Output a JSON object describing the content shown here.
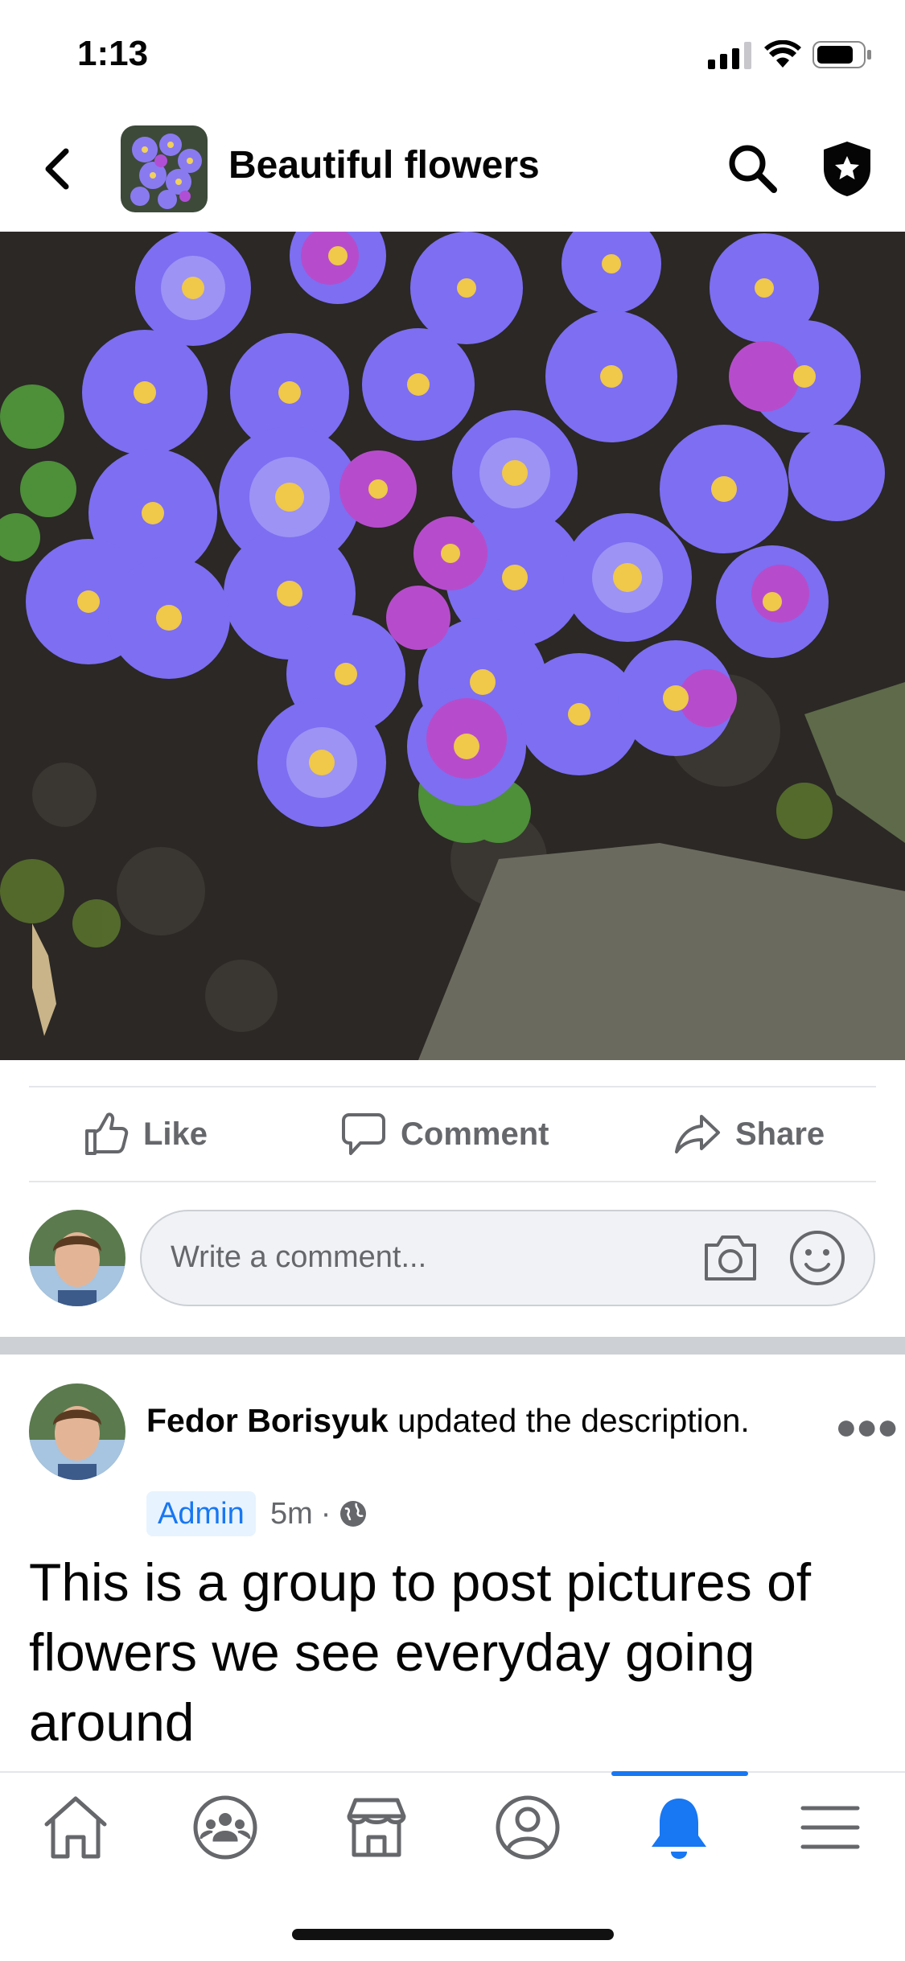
{
  "status": {
    "time": "1:13"
  },
  "header": {
    "title": "Beautiful flowers"
  },
  "actions": {
    "like": "Like",
    "comment": "Comment",
    "share": "Share"
  },
  "composer": {
    "placeholder": "Write a comment..."
  },
  "post": {
    "author": "Fedor Borisyuk",
    "action_text": " updated the description.",
    "badge": "Admin",
    "time": "5m",
    "separator": "·",
    "body": "This is a group to post pictures of flowers we see everyday going around"
  },
  "nav": {
    "items": [
      "home-icon",
      "groups-icon",
      "marketplace-icon",
      "profile-icon",
      "notifications-icon",
      "menu-icon"
    ],
    "active": "notifications-icon"
  },
  "colors": {
    "accent": "#1877f2",
    "muted": "#65676b"
  }
}
